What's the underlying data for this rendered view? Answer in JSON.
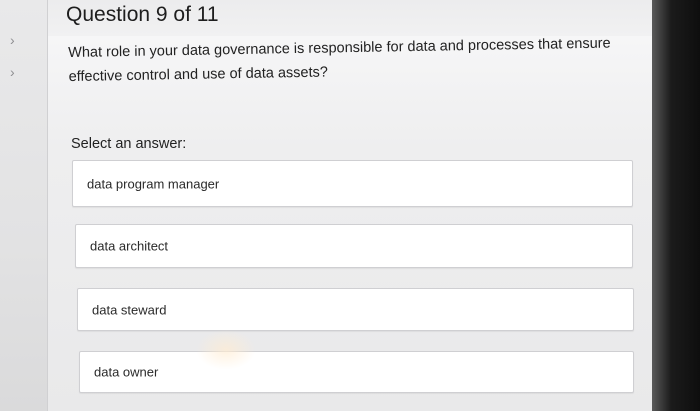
{
  "header": {
    "question_counter": "Question 9 of 11"
  },
  "question": {
    "text": "What role in your data governance is responsible for data and processes that ensure effective control and use of data assets?"
  },
  "answers": {
    "prompt": "Select an answer:",
    "options": [
      "data program manager",
      "data architect",
      "data steward",
      "data owner"
    ]
  },
  "icons": {
    "rail_top": "chevron-right-icon",
    "rail_bottom": "chevron-right-icon"
  }
}
